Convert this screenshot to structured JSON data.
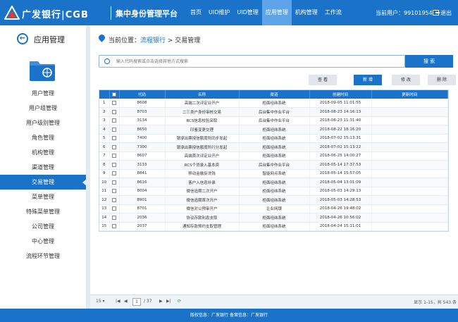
{
  "header": {
    "brand": "广发银行|CGB",
    "system_title": "集中身份管理平台",
    "nav": [
      "首页",
      "UID维护",
      "UID管理",
      "应用管理",
      "机构管理",
      "工作流"
    ],
    "nav_active": 3,
    "user": "当前用户：99101954",
    "logout": "退出"
  },
  "sidebar": {
    "title": "应用管理",
    "items": [
      "用户管理",
      "用户组管理",
      "用户级别管理",
      "角色管理",
      "机构管理",
      "渠道管理",
      "交易管理",
      "菜单管理",
      "特殊菜单管理",
      "公司管理",
      "中心管理",
      "流程环节管理"
    ],
    "active": 6
  },
  "breadcrumb": {
    "prefix": "当前位置：",
    "link": "流程银行",
    "sep": " > ",
    "current": "交易管理"
  },
  "search": {
    "placeholder": "输入代码搜索或点击选择其他方式搜索",
    "button": "搜 索"
  },
  "toolbar": {
    "view": "查 看",
    "add": "新 增",
    "edit": "修 改",
    "delete": "删 除"
  },
  "table": {
    "headers": [
      "",
      "",
      "代码",
      "名称",
      "渠道",
      "创建时间",
      "更新时间"
    ],
    "rows": [
      [
        "1",
        "8608",
        "高端二次评定业开户",
        "柜面经纬系统",
        "2018-09-05 11:01:55",
        ""
      ],
      [
        "2",
        "8703",
        "二三类户身份审核交易",
        "后台集中作业平台",
        "2018-08-23 14:16:13",
        ""
      ],
      [
        "3",
        "3134",
        "RCS信息校验采取",
        "后台集中作业平台",
        "2018-08-23 11:31:40",
        ""
      ],
      [
        "4",
        "8650",
        "印鉴变更交理",
        "柜面经纬系统",
        "2018-08-22 18:16:20",
        ""
      ],
      [
        "5",
        "7400",
        "银承出票授信额度所同步发起",
        "柜面经纬系统",
        "2018-07-02 15:13:31",
        ""
      ],
      [
        "6",
        "7300",
        "银承出票授信额度所行分发起",
        "柜面经纬系统",
        "2018-07-02 15:13:22",
        ""
      ],
      [
        "7",
        "8607",
        "高端首次评定业开户",
        "柜面经纬系统",
        "2018-06-25 14:00:27",
        ""
      ],
      [
        "8",
        "3133",
        "RCS个贷录入基本资",
        "后台集中作业平台",
        "2018-05-14 17:37:53",
        ""
      ],
      [
        "9",
        "8841",
        "移动金融反洗钱",
        "智能网点系统",
        "2018-05-14 15:57:05",
        ""
      ],
      [
        "10",
        "8616",
        "客户入信息补录",
        "柜面经纬系统",
        "2018-05-04 13:01:09",
        ""
      ],
      [
        "11",
        "8004",
        "微信追期二次开户",
        "柜面经纬系统",
        "2018-05-03 14:29:13",
        ""
      ],
      [
        "12",
        "8901",
        "微信追期首次开户",
        "柜面经纬系统",
        "2018-05-03 14:28:53",
        ""
      ],
      [
        "13",
        "8701",
        "微信对公预审开户",
        "企业网银",
        "2018-04-26 19:48:02",
        ""
      ],
      [
        "14",
        "2036",
        "协议存款利息支取",
        "柜面经纬系统",
        "2018-04-26 10:56:02",
        ""
      ],
      [
        "15",
        "2037",
        "通知存款预约支取管理",
        "柜面经纬系统",
        "2018-04-24 15:11:01",
        ""
      ]
    ]
  },
  "pager": {
    "page_size": "15",
    "page": "1",
    "total_pages": "/ 37",
    "summary": "显示 1-15，共 543 条"
  },
  "footer": "版权信息：广发银行     备案信息：广发银行",
  "colors": {
    "primary": "#1a73c9",
    "nav_active": "#5ea4e8"
  }
}
